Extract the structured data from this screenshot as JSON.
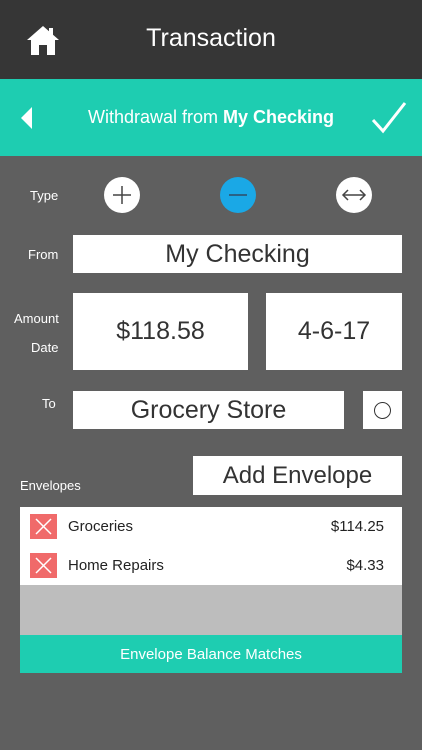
{
  "header": {
    "title": "Transaction"
  },
  "subheader": {
    "prefix": "Withdrawal from",
    "account": "My Checking"
  },
  "form": {
    "type_label": "Type",
    "from_label": "From",
    "from_value": "My Checking",
    "amount_label": "Amount",
    "amount_value": "$118.58",
    "date_label": "Date",
    "date_value": "4-6-17",
    "to_label": "To",
    "to_value": "Grocery Store",
    "envelopes_label": "Envelopes",
    "add_envelope_label": "Add Envelope",
    "selected_type": "withdrawal"
  },
  "envelopes": [
    {
      "name": "Groceries",
      "amount": "$114.25"
    },
    {
      "name": "Home Repairs",
      "amount": "$4.33"
    }
  ],
  "status": {
    "text": "Envelope Balance Matches"
  },
  "icons": {
    "home": "home-icon",
    "back": "back-arrow-icon",
    "confirm": "checkmark-icon",
    "deposit": "plus-icon",
    "withdrawal": "minus-icon",
    "transfer": "transfer-arrows-icon",
    "delete": "close-icon"
  },
  "colors": {
    "accent": "#1ecdb1",
    "active_type": "#1aa8e6",
    "delete": "#f06a6a",
    "topbar": "#363636",
    "background": "#5f5f5f"
  }
}
